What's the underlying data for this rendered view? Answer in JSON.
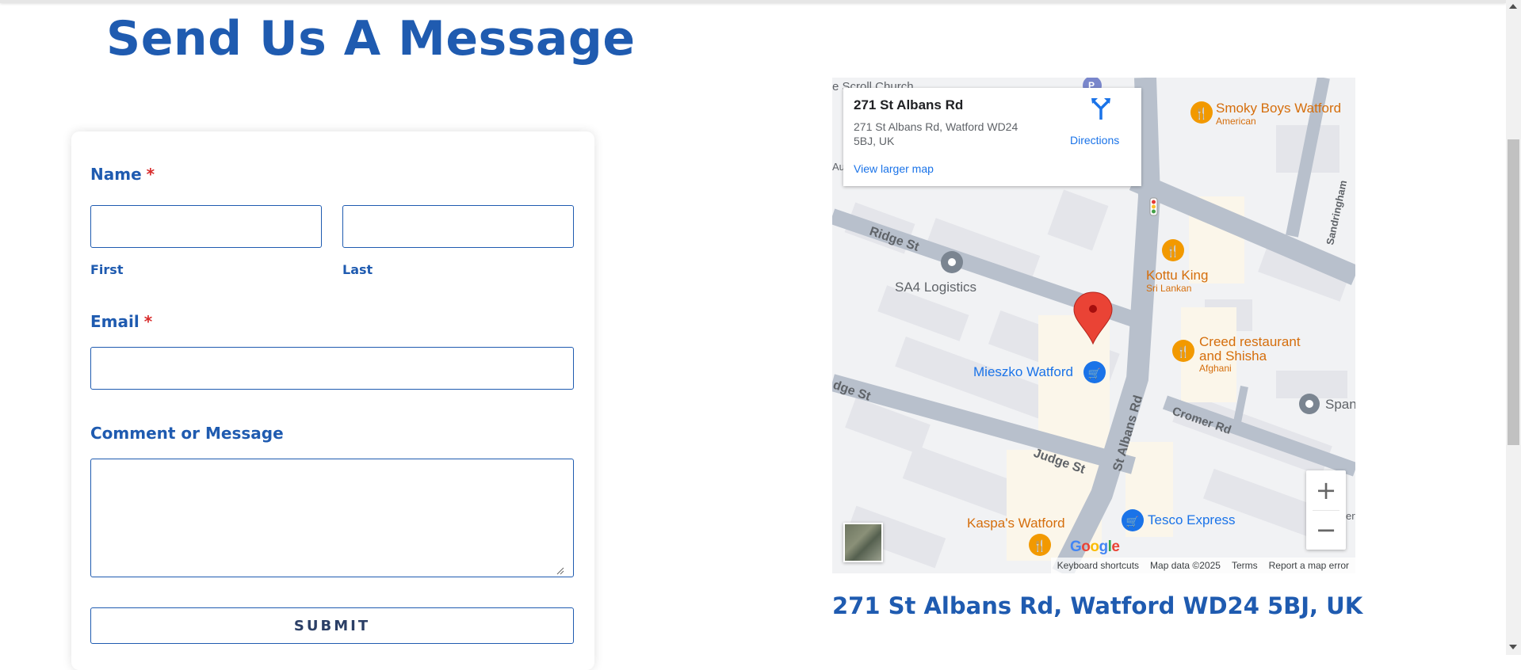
{
  "page": {
    "title": "Send Us A Message"
  },
  "form": {
    "name_label": "Name",
    "required_mark": "*",
    "first_sub": "First",
    "last_sub": "Last",
    "email_label": "Email",
    "comment_label": "Comment or Message",
    "submit_label": "SUBMIT",
    "first_value": "",
    "last_value": "",
    "email_value": "",
    "comment_value": ""
  },
  "map": {
    "card_title": "271 St Albans Rd",
    "card_address": "271 St Albans Rd, Watford WD24 5BJ, UK",
    "view_larger": "View larger map",
    "directions": "Directions",
    "zoom_in": "+",
    "zoom_out": "−",
    "footer": {
      "shortcuts": "Keyboard shortcuts",
      "data": "Map data ©2025",
      "terms": "Terms",
      "report": "Report a map error"
    },
    "streets": {
      "ridge1": "Ridge St",
      "ridge2": "dge St",
      "judge": "Judge St",
      "stalbans": "St Albans Rd",
      "cromer": "Cromer Rd",
      "sandringham": "Sandringham",
      "church": "e Scroll Church",
      "church_edge": "Au"
    },
    "pois": {
      "smoky": "Smoky Boys Watford",
      "smoky_sub": "American",
      "kottu": "Kottu King",
      "kottu_sub": "Sri Lankan",
      "creed1": "Creed restaurant",
      "creed2": "and Shisha",
      "creed_sub": "Afghani",
      "sa4": "SA4 Logistics",
      "mieszko": "Mieszko Watford",
      "tesco": "Tesco Express",
      "kaspa": "Kaspa's Watford",
      "span": "Span",
      "parking": "P",
      "edge_r": "ert"
    },
    "colors": {
      "orange": "#d56e0c",
      "blue": "#1a73e8",
      "pin": "#ea4335"
    }
  },
  "address_caption": "271 St Albans Rd, Watford WD24 5BJ, UK",
  "colors": {
    "brand": "#1f5bb0",
    "required": "#d82b2b"
  }
}
